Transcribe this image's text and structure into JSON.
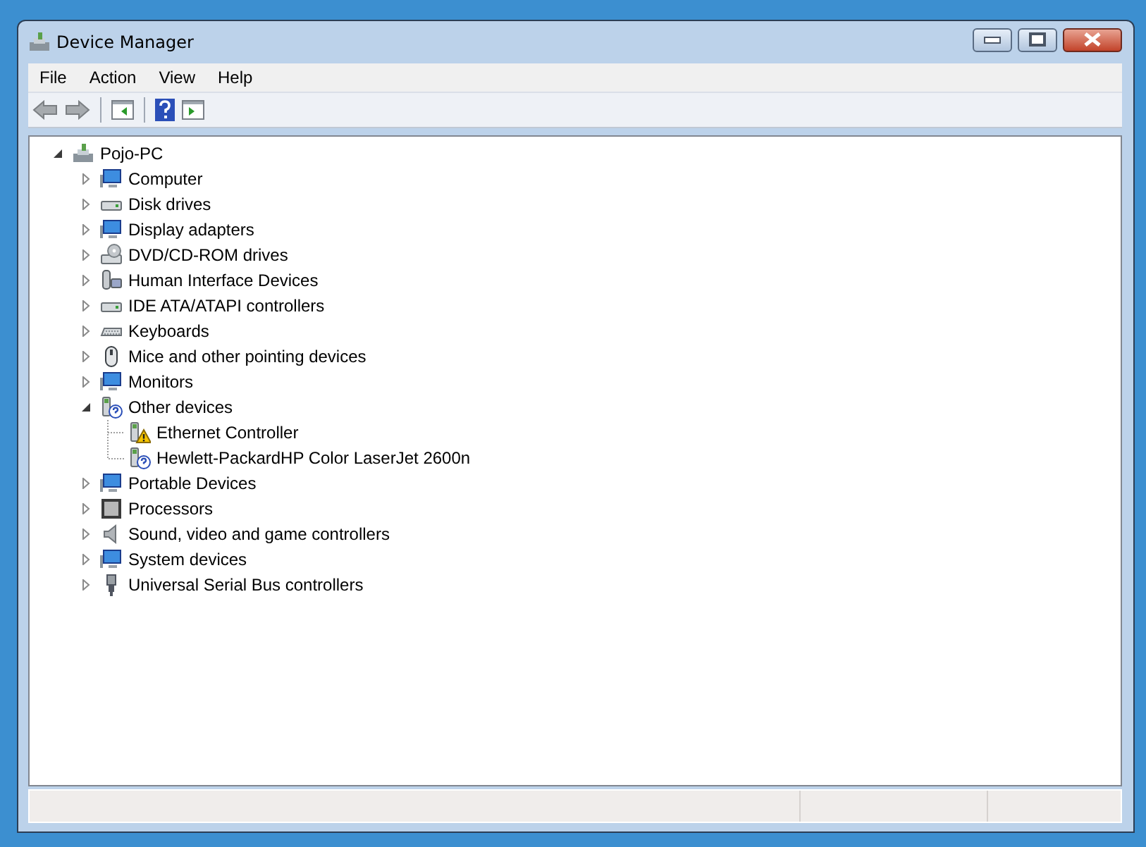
{
  "window": {
    "title": "Device Manager"
  },
  "menu": [
    "File",
    "Action",
    "View",
    "Help"
  ],
  "tree": [
    {
      "label": "Pojo-PC",
      "kind": "computer",
      "expanded": true,
      "children": [
        {
          "label": "Computer",
          "kind": "monitor",
          "expanded": false
        },
        {
          "label": "Disk drives",
          "kind": "drive",
          "expanded": false
        },
        {
          "label": "Display adapters",
          "kind": "monitor",
          "expanded": false
        },
        {
          "label": "DVD/CD-ROM drives",
          "kind": "disc",
          "expanded": false
        },
        {
          "label": "Human Interface Devices",
          "kind": "device",
          "expanded": false
        },
        {
          "label": "IDE ATA/ATAPI controllers",
          "kind": "drive",
          "expanded": false
        },
        {
          "label": "Keyboards",
          "kind": "keyboard",
          "expanded": false
        },
        {
          "label": "Mice and other pointing devices",
          "kind": "mouse",
          "expanded": false
        },
        {
          "label": "Monitors",
          "kind": "monitor",
          "expanded": false
        },
        {
          "label": "Other devices",
          "kind": "unknown",
          "expanded": true,
          "children": [
            {
              "label": "Ethernet Controller",
              "kind": "warning"
            },
            {
              "label": "Hewlett-PackardHP Color LaserJet 2600n",
              "kind": "unknown"
            }
          ]
        },
        {
          "label": "Portable Devices",
          "kind": "monitor",
          "expanded": false
        },
        {
          "label": "Processors",
          "kind": "chip",
          "expanded": false
        },
        {
          "label": "Sound, video and game controllers",
          "kind": "speaker",
          "expanded": false
        },
        {
          "label": "System devices",
          "kind": "monitor",
          "expanded": false
        },
        {
          "label": "Universal Serial Bus controllers",
          "kind": "usb",
          "expanded": false
        }
      ]
    }
  ]
}
